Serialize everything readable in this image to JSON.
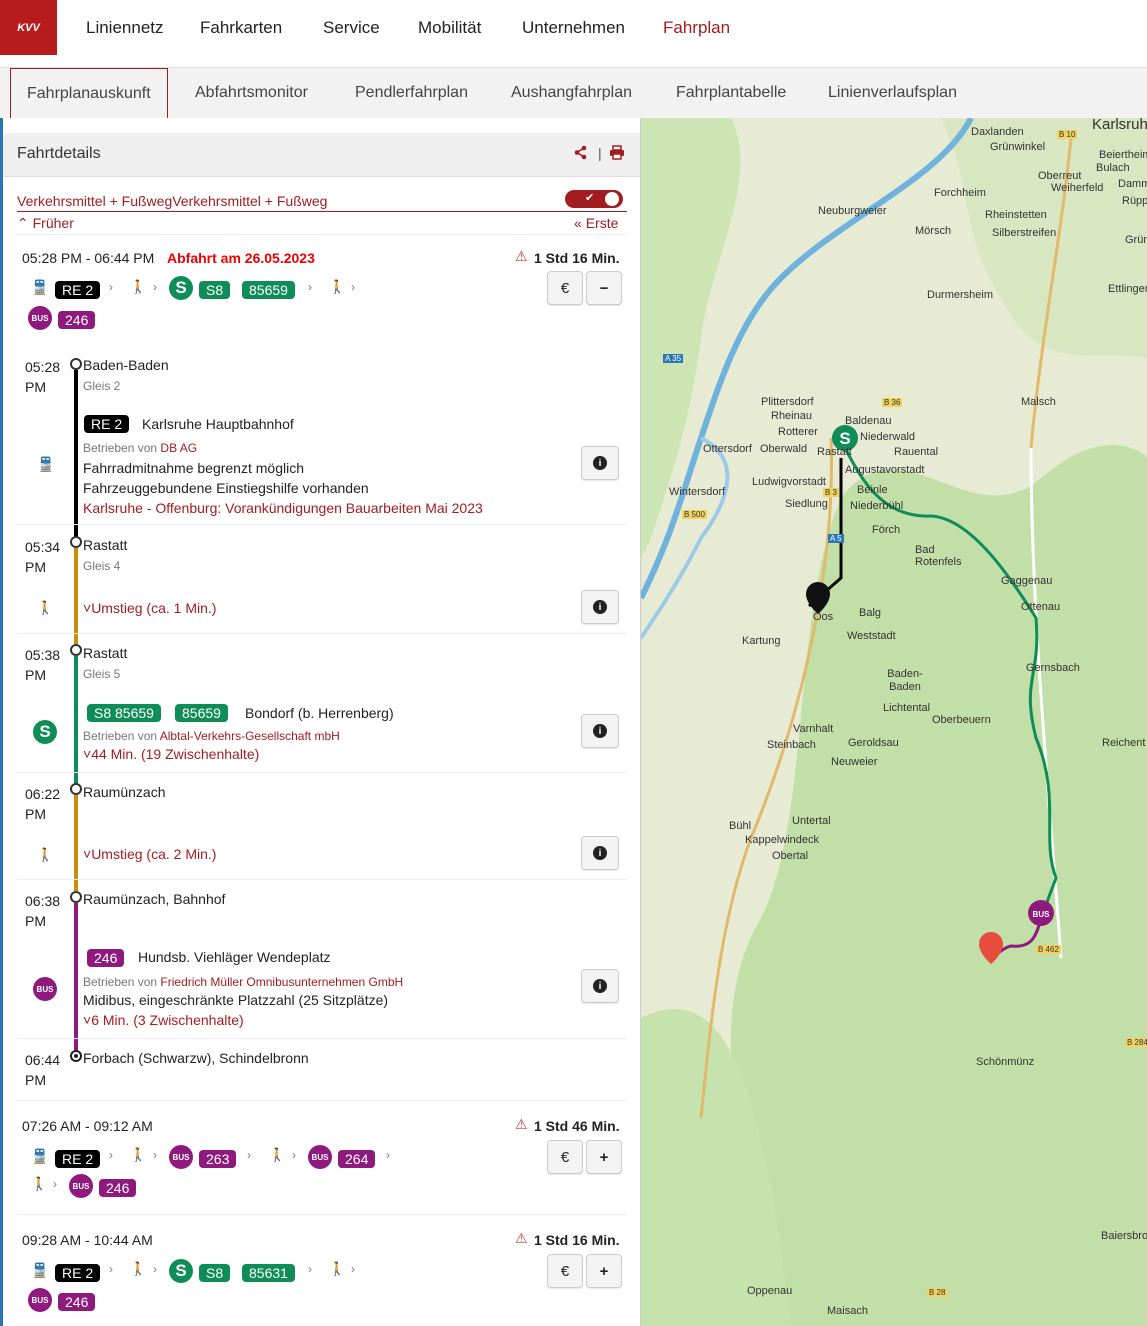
{
  "nav": {
    "logo": "KVV",
    "items": [
      "Liniennetz",
      "Fahrkarten",
      "Service",
      "Mobilität",
      "Unternehmen",
      "Fahrplan"
    ]
  },
  "subnav": {
    "items": [
      "Fahrplanauskunft",
      "Abfahrtsmonitor",
      "Pendlerfahrplan",
      "Aushangfahrplan",
      "Fahrplantabelle",
      "Linienverlaufsplan"
    ]
  },
  "panel": {
    "title": "Fahrtdetails",
    "share_icon": "share-icon",
    "print_icon": "print-icon",
    "mode_label": "Verkehrsmittel + FußwegVerkehrsmittel + Fußweg",
    "earlier": "Früher",
    "first": "Erste"
  },
  "trip1": {
    "time": "05:28 PM - 06:44 PM",
    "departure": "Abfahrt am 26.05.2023",
    "duration": "1 Std 16 Min.",
    "lines": {
      "re": "RE 2",
      "s_line": "S8",
      "s_num": "85659",
      "bus": "246"
    }
  },
  "legs": {
    "stop1": {
      "time": "05:28",
      "ampm": "PM",
      "name": "Baden-Baden",
      "platform": "Gleis 2"
    },
    "leg1": {
      "line": "RE 2",
      "dest": "Karlsruhe Hauptbahnhof",
      "operated_by": "Betrieben von",
      "operator": "DB AG",
      "note1": "Fahrradmitnahme begrenzt möglich",
      "note2": "Fahrzeuggebundene Einstiegshilfe vorhanden",
      "notice": "Karlsruhe - Offenburg: Vorankündigungen Bauarbeiten Mai 2023"
    },
    "stop2": {
      "time": "05:34",
      "ampm": "PM",
      "name": "Rastatt",
      "platform": "Gleis 4"
    },
    "walk1": "Umstieg (ca. 1 Min.)",
    "stop3": {
      "time": "05:38",
      "ampm": "PM",
      "name": "Rastatt",
      "platform": "Gleis 5"
    },
    "leg2": {
      "line": "S8 85659",
      "num": "85659",
      "dest": "Bondorf (b. Herrenberg)",
      "operated_by": "Betrieben von",
      "operator": "Albtal-Verkehrs-Gesellschaft mbH",
      "stops": "44 Min. (19 Zwischenhalte)"
    },
    "stop4": {
      "time": "06:22",
      "ampm": "PM",
      "name": "Raumünzach"
    },
    "walk2": "Umstieg (ca. 2 Min.)",
    "stop5": {
      "time": "06:38",
      "ampm": "PM",
      "name": "Raumünzach, Bahnhof"
    },
    "leg3": {
      "line": "246",
      "dest": "Hundsb. Viehläger Wendeplatz",
      "operated_by": "Betrieben von",
      "operator": "Friedrich Müller Omnibusunternehmen GmbH",
      "note1": "Midibus, eingeschränkte Platzzahl (25 Sitzplätze)",
      "stops": "6 Min. (3 Zwischenhalte)"
    },
    "stop6": {
      "time": "06:44",
      "ampm": "PM",
      "name": "Forbach (Schwarzw), Schindelbronn"
    }
  },
  "trip2": {
    "time": "07:26 AM - 09:12 AM",
    "duration": "1 Std 46 Min.",
    "lines": {
      "re": "RE 2",
      "bus1": "263",
      "bus2": "264",
      "bus3": "246"
    }
  },
  "trip3": {
    "time": "09:28 AM - 10:44 AM",
    "duration": "1 Std 16 Min.",
    "lines": {
      "re": "RE 2",
      "s_line": "S8",
      "s_num": "85631",
      "bus": "246"
    }
  },
  "common": {
    "s_letter": "S",
    "bus_label": "BUS",
    "euro": "€",
    "minus": "−",
    "plus": "+",
    "info": "i"
  },
  "map": {
    "labels": [
      "Karlsruhe",
      "Daxlanden",
      "Grünwinkel",
      "Beiertheim",
      "Bulach",
      "Oberreut",
      "Weiherfeld",
      "Damm",
      "Rüpp",
      "Forchheim",
      "Neuburgweier",
      "Rheinstetten",
      "Mörsch",
      "Silberstreifen",
      "Grün",
      "Ettlingen",
      "Durmersheim",
      "Malsch",
      "Plittersdorf",
      "Rheinau",
      "Rotterer",
      "Baldenau",
      "Niederwald",
      "Rauental",
      "Ottersdorf",
      "Oberwald",
      "Rastatt",
      "Augustavorstadt",
      "Ludwigvorstadt",
      "Wintersdorf",
      "Beinle",
      "Niederbühl",
      "Siedlung",
      "Förch",
      "Bad Rotenfels",
      "Gaggenau",
      "Ottenau",
      "Oos",
      "Balg",
      "Kartung",
      "Weststadt",
      "Gernsbach",
      "Baden-Baden",
      "Lichtental",
      "Oberbeuern",
      "Varnhalt",
      "Steinbach",
      "Geroldsau",
      "Neuweier",
      "Reichent",
      "Bühl",
      "Untertal",
      "Kappelwindeck",
      "Obertal",
      "Schönmünz",
      "Baiersbronn",
      "Oppenau",
      "Maisach",
      "A 35",
      "A 5",
      "B 3",
      "B 36",
      "B 500",
      "B 462",
      "B 28",
      "B 10",
      "B 284"
    ]
  }
}
